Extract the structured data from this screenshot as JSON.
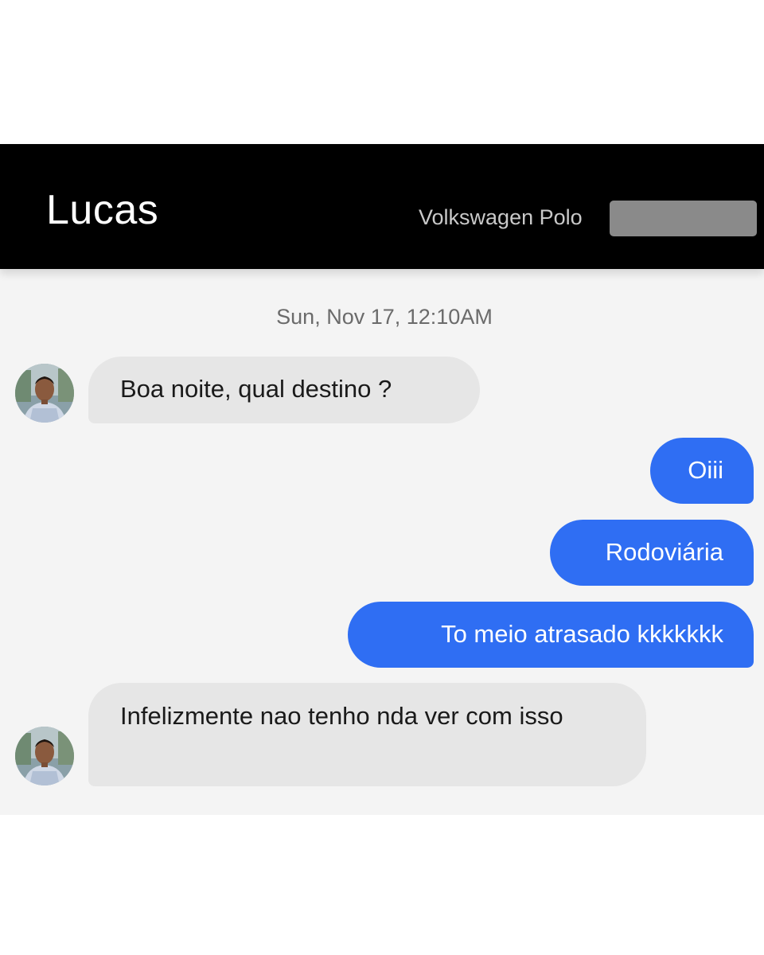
{
  "header": {
    "driver_name": "Lucas",
    "vehicle": "Volkswagen Polo"
  },
  "conversation": {
    "timestamp": "Sun, Nov 17, 12:10AM",
    "messages": [
      {
        "sender": "driver",
        "text": "Boa noite, qual destino ?"
      },
      {
        "sender": "me",
        "text": "Oiii"
      },
      {
        "sender": "me",
        "text": "Rodoviária"
      },
      {
        "sender": "me",
        "text": "To meio atrasado kkkkkkk"
      },
      {
        "sender": "driver",
        "text": "Infelizmente nao tenho nda ver com isso"
      }
    ]
  },
  "colors": {
    "header_bg": "#000000",
    "outgoing_bubble": "#2f6ef3",
    "incoming_bubble": "#e6e6e6",
    "chat_bg": "#f4f4f4"
  },
  "icons": [
    "driver-avatar",
    "redacted-license-plate"
  ]
}
